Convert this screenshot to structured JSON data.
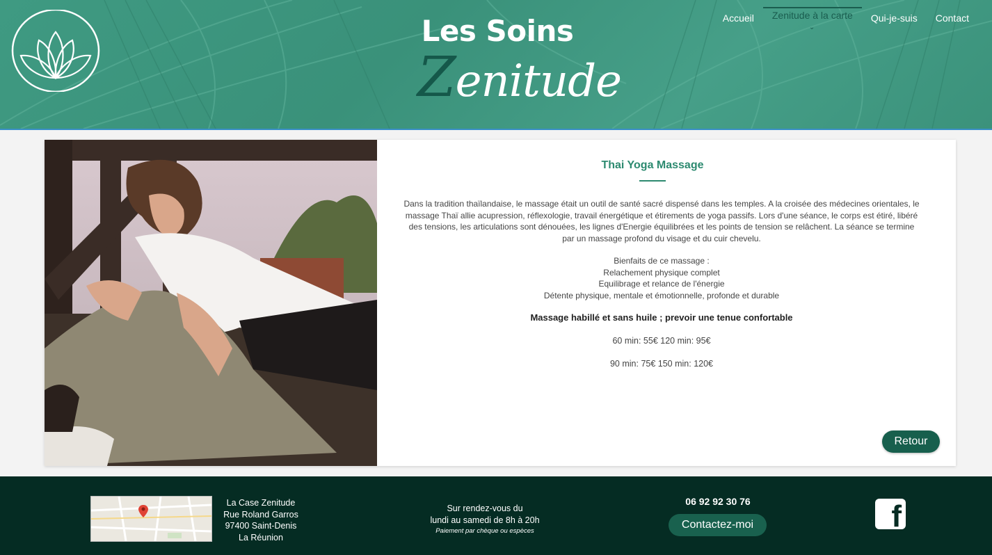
{
  "header": {
    "brand_line1": "Les Soins",
    "brand_line2_first": "Z",
    "brand_line2_rest": "enitude",
    "logo_icon": "lotus-icon",
    "accent_color": "#3f9a82"
  },
  "nav": {
    "items": [
      {
        "label": "Accueil",
        "active": false
      },
      {
        "label": "Zenitude à la carte",
        "active": true
      },
      {
        "label": "Qui-je-suis",
        "active": false
      },
      {
        "label": "Contact",
        "active": false
      }
    ]
  },
  "card": {
    "title": "Thai Yoga Massage",
    "description": "Dans la tradition thaïlandaise, le massage était un outil de santé sacré dispensé dans les temples. A la croisée des médecines orientales, le massage Thaï allie acupression, réflexologie, travail énergétique et étirements de yoga passifs. Lors d'une séance, le corps est étiré, libéré des tensions, les articulations sont dénouées, les lignes d'Energie équilibrées et les points de tension se relâchent. La séance se termine par un massage profond du visage et du cuir chevelu.",
    "benefits_heading": "Bienfaits de ce massage :",
    "benefits": [
      "Relachement physique complet",
      "Equilibrage et relance de l'énergie",
      "Détente physique, mentale et émotionnelle, profonde et durable"
    ],
    "note": "Massage habillé et sans huile ; prevoir une tenue confortable",
    "price_line1": "60 min: 55€ 120 min: 95€",
    "price_line2": "90 min: 75€ 150 min: 120€",
    "back_button": "Retour"
  },
  "footer": {
    "address": [
      "La Case Zenitude",
      "Rue Roland Garros",
      "97400 Saint-Denis",
      "La Réunion"
    ],
    "hours_line1": "Sur rendez-vous du",
    "hours_line2": "lundi au samedi de 8h à 20h",
    "payment": "Paiement par chèque ou espèces",
    "phone": "06 92 92 30 76",
    "contact_button": "Contactez-moi",
    "social_icon": "facebook-icon",
    "background_color": "#052c23"
  }
}
